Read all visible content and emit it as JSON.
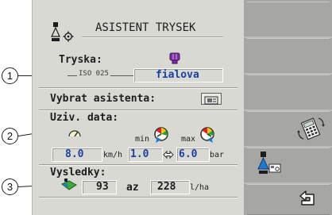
{
  "header": {
    "title": "ASISTENT TRYSEK",
    "icon": "nozzle-gear-icon"
  },
  "nozzle": {
    "label": "Tryska:",
    "iso_code": "ISO 025",
    "color_name": "fialova",
    "color_hex": "#7b2fa8"
  },
  "assistant": {
    "label": "Vybrat asistenta:",
    "icon": "assistant-card-icon"
  },
  "user_data": {
    "label": "Uziv. data:",
    "speed": {
      "value": "8.0",
      "unit": "km/h",
      "icon": "speedometer-icon"
    },
    "pressure_min": {
      "prefix": "min",
      "value": "1.0",
      "icon": "pressure-gauge-min-icon"
    },
    "pressure_max": {
      "prefix": "max",
      "value": "6.0",
      "unit": "bar",
      "icon": "pressure-gauge-max-icon"
    },
    "swap_icon": "swap-arrows-icon"
  },
  "results": {
    "label": "Vysledky:",
    "from": "93",
    "to_word": "az",
    "to": "228",
    "unit": "l/ha",
    "icon": "field-rate-icon"
  },
  "callouts": [
    "1",
    "2",
    "3"
  ],
  "softkeys": [
    {
      "icon": ""
    },
    {
      "icon": ""
    },
    {
      "icon": ""
    },
    {
      "icon": "calculator-swap-icon"
    },
    {
      "icon": "nozzle-settings-icon"
    },
    {
      "icon": "back-arrow-icon"
    }
  ],
  "colors": {
    "value_text": "#1a3fa8",
    "panel_bg": "#d9d9d4",
    "softkey_bg": "#a6a6a2"
  }
}
